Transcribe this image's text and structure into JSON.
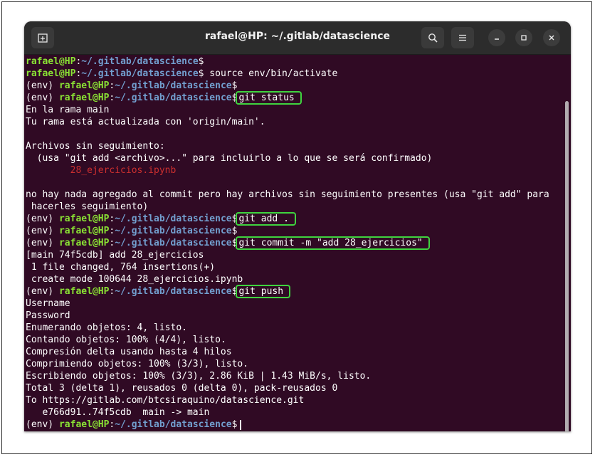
{
  "window": {
    "title": "rafael@HP: ~/.gitlab/datascience"
  },
  "icons": {
    "new_tab": "new-tab-icon",
    "search": "search-icon",
    "menu": "hamburger-menu-icon",
    "minimize": "minimize-icon",
    "maximize": "maximize-icon",
    "close": "close-icon"
  },
  "colors": {
    "prompt_user": "#8ae234",
    "prompt_path": "#729fcf",
    "untracked": "#cc2f2f",
    "highlight_box": "#3fd43f"
  },
  "prompt": {
    "user": "rafael@HP",
    "colon": ":",
    "path": "~/.gitlab/datascience",
    "dollar": "$",
    "env": "(env) "
  },
  "lines": [
    {
      "type": "prompt",
      "env": false,
      "cmd": ""
    },
    {
      "type": "prompt",
      "env": false,
      "cmd": " source env/bin/activate"
    },
    {
      "type": "prompt",
      "env": true,
      "cmd": ""
    },
    {
      "type": "prompt",
      "env": true,
      "cmd": "git status",
      "highlight": true
    },
    {
      "type": "text",
      "text": "En la rama main"
    },
    {
      "type": "text",
      "text": "Tu rama está actualizada con 'origin/main'."
    },
    {
      "type": "text",
      "text": ""
    },
    {
      "type": "text",
      "text": "Archivos sin seguimiento:"
    },
    {
      "type": "text",
      "text": "  (usa \"git add <archivo>...\" para incluirlo a lo que se será confirmado)"
    },
    {
      "type": "untracked",
      "text": "        28_ejercicios.ipynb"
    },
    {
      "type": "text",
      "text": ""
    },
    {
      "type": "text",
      "text": "no hay nada agregado al commit pero hay archivos sin seguimiento presentes (usa \"git add\" para"
    },
    {
      "type": "text",
      "text": " hacerles seguimiento)"
    },
    {
      "type": "prompt",
      "env": true,
      "cmd": "git add .",
      "highlight": true
    },
    {
      "type": "prompt",
      "env": true,
      "cmd": ""
    },
    {
      "type": "prompt",
      "env": true,
      "cmd": "git commit -m \"add 28_ejercicios\"",
      "highlight": true
    },
    {
      "type": "text",
      "text": "[main 74f5cdb] add 28_ejercicios"
    },
    {
      "type": "text",
      "text": " 1 file changed, 764 insertions(+)"
    },
    {
      "type": "text",
      "text": " create mode 100644 28_ejercicios.ipynb"
    },
    {
      "type": "prompt",
      "env": true,
      "cmd": "git push",
      "highlight": true
    },
    {
      "type": "text",
      "text": "Username"
    },
    {
      "type": "text",
      "text": "Password"
    },
    {
      "type": "text",
      "text": "Enumerando objetos: 4, listo."
    },
    {
      "type": "text",
      "text": "Contando objetos: 100% (4/4), listo."
    },
    {
      "type": "text",
      "text": "Compresión delta usando hasta 4 hilos"
    },
    {
      "type": "text",
      "text": "Comprimiendo objetos: 100% (3/3), listo."
    },
    {
      "type": "text",
      "text": "Escribiendo objetos: 100% (3/3), 2.86 KiB | 1.43 MiB/s, listo."
    },
    {
      "type": "text",
      "text": "Total 3 (delta 1), reusados 0 (delta 0), pack-reusados 0"
    },
    {
      "type": "text",
      "text": "To https://gitlab.com/btcsiraquino/datascience.git"
    },
    {
      "type": "text",
      "text": "   e766d91..74f5cdb  main -> main"
    },
    {
      "type": "prompt",
      "env": true,
      "cmd": "",
      "cursor": true
    }
  ]
}
